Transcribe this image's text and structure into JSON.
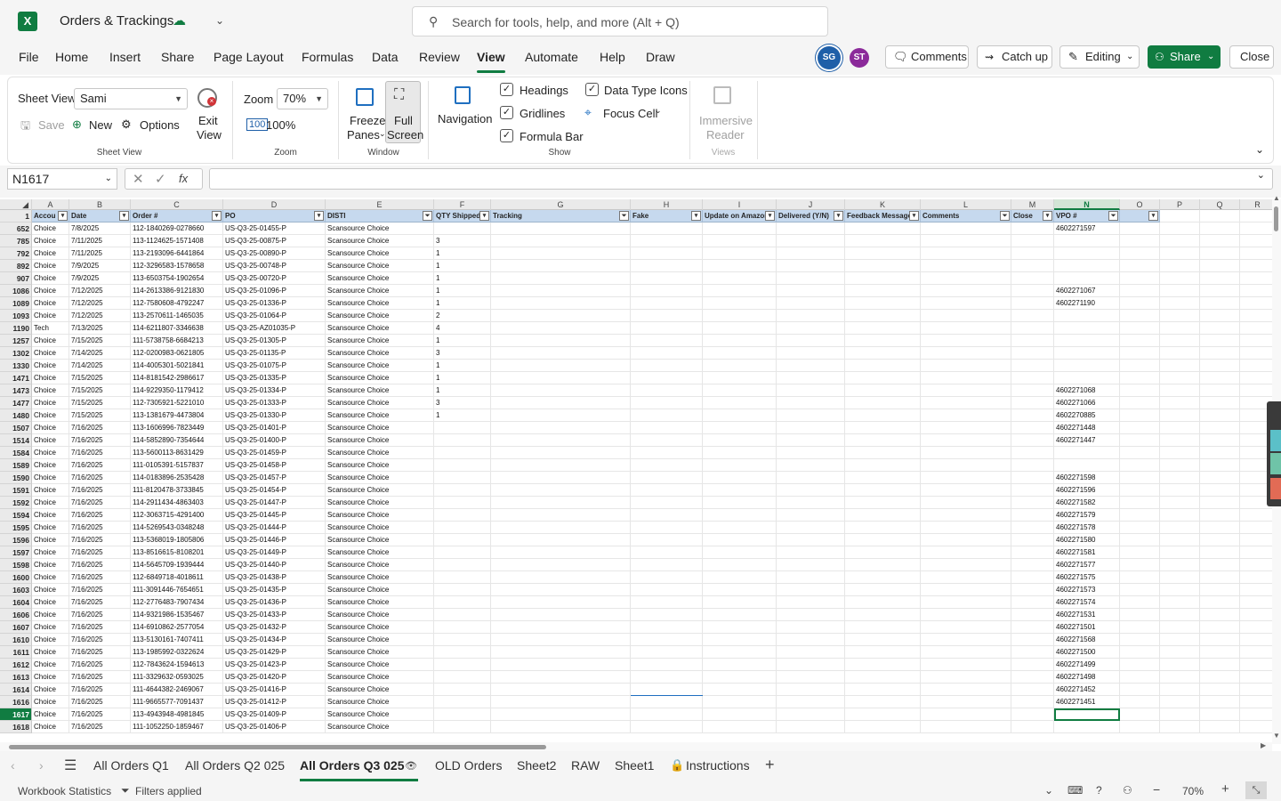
{
  "app": {
    "title": "Orders & Trackings",
    "search_placeholder": "Search for tools, help, and more (Alt + Q)"
  },
  "menu": [
    "File",
    "Home",
    "Insert",
    "Share",
    "Page Layout",
    "Formulas",
    "Data",
    "Review",
    "View",
    "Automate",
    "Help",
    "Draw"
  ],
  "active_menu": "View",
  "avatars": [
    {
      "initials": "SG",
      "color": "#1f5fa8"
    },
    {
      "initials": "ST",
      "color": "#8b2a9a"
    }
  ],
  "header_buttons": {
    "comments": "Comments",
    "catchup": "Catch up",
    "editing": "Editing",
    "share": "Share",
    "close": "Close"
  },
  "ribbon": {
    "sheet_view_label": "Sheet View",
    "sheet_view_value": "Sami",
    "save": "Save",
    "new": "New",
    "options": "Options",
    "exit_view_1": "Exit",
    "exit_view_2": "View",
    "sheet_view_group": "Sheet View",
    "zoom_label": "Zoom",
    "zoom_value": "70%",
    "zoom_100": "100%",
    "zoom_group": "Zoom",
    "freeze_1": "Freeze",
    "freeze_2": "Panes",
    "fullscreen_1": "Full",
    "fullscreen_2": "Screen",
    "window_group": "Window",
    "navigation": "Navigation",
    "headings": "Headings",
    "gridlines": "Gridlines",
    "formula_bar": "Formula Bar",
    "data_type_icons": "Data Type Icons",
    "focus_cell": "Focus Cell",
    "show_group": "Show",
    "immersive_1": "Immersive",
    "immersive_2": "Reader",
    "views_group": "Views"
  },
  "formula": {
    "namebox": "N1617",
    "fx": "fx",
    "content": ""
  },
  "columns": [
    "A",
    "B",
    "C",
    "D",
    "E",
    "F",
    "G",
    "H",
    "I",
    "J",
    "K",
    "L",
    "M",
    "N",
    "O",
    "P",
    "Q",
    "R"
  ],
  "selected_column": "N",
  "header_row_number": "1",
  "headers": [
    "Accou",
    "Date",
    "Order #",
    "PO",
    "DISTI",
    "QTY Shipped",
    "Tracking",
    "Fake",
    "Update on Amazon",
    "Delivered (Y/N)",
    "Feedback Message",
    "Comments",
    "Close",
    "VPO #",
    "",
    "",
    "",
    ""
  ],
  "rows": [
    {
      "num": "652",
      "a": "Choice",
      "b": "7/8/2025",
      "c": "112-1840269-0278660",
      "d": "US-Q3-25-01455-P",
      "e": "Scansource Choice",
      "f": "",
      "n": "4602271597"
    },
    {
      "num": "785",
      "a": "Choice",
      "b": "7/11/2025",
      "c": "113-1124625-1571408",
      "d": "US-Q3-25-00875-P",
      "e": "Scansource Choice",
      "f": "3",
      "n": ""
    },
    {
      "num": "792",
      "a": "Choice",
      "b": "7/11/2025",
      "c": "113-2193096-6441864",
      "d": "US-Q3-25-00890-P",
      "e": "Scansource Choice",
      "f": "1",
      "n": ""
    },
    {
      "num": "892",
      "a": "Choice",
      "b": "7/9/2025",
      "c": "112-3296583-1578658",
      "d": "US-Q3-25-00748-P",
      "e": "Scansource Choice",
      "f": "1",
      "n": ""
    },
    {
      "num": "907",
      "a": "Choice",
      "b": "7/9/2025",
      "c": "113-6503754-1902654",
      "d": "US-Q3-25-00720-P",
      "e": "Scansource Choice",
      "f": "1",
      "n": ""
    },
    {
      "num": "1086",
      "a": "Choice",
      "b": "7/12/2025",
      "c": "114-2613386-9121830",
      "d": "US-Q3-25-01096-P",
      "e": "Scansource Choice",
      "f": "1",
      "n": "4602271067"
    },
    {
      "num": "1089",
      "a": "Choice",
      "b": "7/12/2025",
      "c": "112-7580608-4792247",
      "d": "US-Q3-25-01336-P",
      "e": "Scansource Choice",
      "f": "1",
      "n": "4602271190"
    },
    {
      "num": "1093",
      "a": "Choice",
      "b": "7/12/2025",
      "c": "113-2570611-1465035",
      "d": "US-Q3-25-01064-P",
      "e": "Scansource Choice",
      "f": "2",
      "n": ""
    },
    {
      "num": "1190",
      "a": "Tech",
      "b": "7/13/2025",
      "c": "114-6211807-3346638",
      "d": "US-Q3-25-AZ01035-P",
      "e": "Scansource Choice",
      "f": "4",
      "n": ""
    },
    {
      "num": "1257",
      "a": "Choice",
      "b": "7/15/2025",
      "c": "111-5738758-6684213",
      "d": "US-Q3-25-01305-P",
      "e": "Scansource Choice",
      "f": "1",
      "n": ""
    },
    {
      "num": "1302",
      "a": "Choice",
      "b": "7/14/2025",
      "c": "112-0200983-0621805",
      "d": "US-Q3-25-01135-P",
      "e": "Scansource Choice",
      "f": "3",
      "n": ""
    },
    {
      "num": "1330",
      "a": "Choice",
      "b": "7/14/2025",
      "c": "114-4005301-5021841",
      "d": "US-Q3-25-01075-P",
      "e": "Scansource Choice",
      "f": "1",
      "n": ""
    },
    {
      "num": "1471",
      "a": "Choice",
      "b": "7/15/2025",
      "c": "114-8181542-2986617",
      "d": "US-Q3-25-01335-P",
      "e": "Scansource Choice",
      "f": "1",
      "n": ""
    },
    {
      "num": "1473",
      "a": "Choice",
      "b": "7/15/2025",
      "c": "114-9229350-1179412",
      "d": "US-Q3-25-01334-P",
      "e": "Scansource Choice",
      "f": "1",
      "n": "4602271068"
    },
    {
      "num": "1477",
      "a": "Choice",
      "b": "7/15/2025",
      "c": "112-7305921-5221010",
      "d": "US-Q3-25-01333-P",
      "e": "Scansource Choice",
      "f": "3",
      "n": "4602271066"
    },
    {
      "num": "1480",
      "a": "Choice",
      "b": "7/15/2025",
      "c": "113-1381679-4473804",
      "d": "US-Q3-25-01330-P",
      "e": "Scansource Choice",
      "f": "1",
      "n": "4602270885"
    },
    {
      "num": "1507",
      "a": "Choice",
      "b": "7/16/2025",
      "c": "113-1606996-7823449",
      "d": "US-Q3-25-01401-P",
      "e": "Scansource Choice",
      "f": "",
      "n": "4602271448"
    },
    {
      "num": "1514",
      "a": "Choice",
      "b": "7/16/2025",
      "c": "114-5852890-7354644",
      "d": "US-Q3-25-01400-P",
      "e": "Scansource Choice",
      "f": "",
      "n": "4602271447"
    },
    {
      "num": "1584",
      "a": "Choice",
      "b": "7/16/2025",
      "c": "113-5600113-8631429",
      "d": "US-Q3-25-01459-P",
      "e": "Scansource Choice",
      "f": "",
      "n": ""
    },
    {
      "num": "1589",
      "a": "Choice",
      "b": "7/16/2025",
      "c": "111-0105391-5157837",
      "d": "US-Q3-25-01458-P",
      "e": "Scansource Choice",
      "f": "",
      "n": ""
    },
    {
      "num": "1590",
      "a": "Choice",
      "b": "7/16/2025",
      "c": "114-0183896-2535428",
      "d": "US-Q3-25-01457-P",
      "e": "Scansource Choice",
      "f": "",
      "n": "4602271598"
    },
    {
      "num": "1591",
      "a": "Choice",
      "b": "7/16/2025",
      "c": "111-8120478-3733845",
      "d": "US-Q3-25-01454-P",
      "e": "Scansource Choice",
      "f": "",
      "n": "4602271596"
    },
    {
      "num": "1592",
      "a": "Choice",
      "b": "7/16/2025",
      "c": "114-2911434-4863403",
      "d": "US-Q3-25-01447-P",
      "e": "Scansource Choice",
      "f": "",
      "n": "4602271582"
    },
    {
      "num": "1594",
      "a": "Choice",
      "b": "7/16/2025",
      "c": "112-3063715-4291400",
      "d": "US-Q3-25-01445-P",
      "e": "Scansource Choice",
      "f": "",
      "n": "4602271579"
    },
    {
      "num": "1595",
      "a": "Choice",
      "b": "7/16/2025",
      "c": "114-5269543-0348248",
      "d": "US-Q3-25-01444-P",
      "e": "Scansource Choice",
      "f": "",
      "n": "4602271578"
    },
    {
      "num": "1596",
      "a": "Choice",
      "b": "7/16/2025",
      "c": "113-5368019-1805806",
      "d": "US-Q3-25-01446-P",
      "e": "Scansource Choice",
      "f": "",
      "n": "4602271580"
    },
    {
      "num": "1597",
      "a": "Choice",
      "b": "7/16/2025",
      "c": "113-8516615-8108201",
      "d": "US-Q3-25-01449-P",
      "e": "Scansource Choice",
      "f": "",
      "n": "4602271581"
    },
    {
      "num": "1598",
      "a": "Choice",
      "b": "7/16/2025",
      "c": "114-5645709-1939444",
      "d": "US-Q3-25-01440-P",
      "e": "Scansource Choice",
      "f": "",
      "n": "    4602271577"
    },
    {
      "num": "1600",
      "a": "Choice",
      "b": "7/16/2025",
      "c": "112-6849718-4018611",
      "d": "US-Q3-25-01438-P",
      "e": "Scansource Choice",
      "f": "",
      "n": "4602271575"
    },
    {
      "num": "1603",
      "a": "Choice",
      "b": "7/16/2025",
      "c": "111-3091446-7654651",
      "d": "US-Q3-25-01435-P",
      "e": "Scansource Choice",
      "f": "",
      "n": "4602271573"
    },
    {
      "num": "1604",
      "a": "Choice",
      "b": "7/16/2025",
      "c": "112-2776483-7907434",
      "d": "US-Q3-25-01436-P",
      "e": "Scansource Choice",
      "f": "",
      "n": "4602271574"
    },
    {
      "num": "1606",
      "a": "Choice",
      "b": "7/16/2025",
      "c": "114-9321986-1535467",
      "d": "US-Q3-25-01433-P",
      "e": "Scansource Choice",
      "f": "",
      "n": "4602271531"
    },
    {
      "num": "1607",
      "a": "Choice",
      "b": "7/16/2025",
      "c": "114-6910862-2577054",
      "d": "US-Q3-25-01432-P",
      "e": "Scansource Choice",
      "f": "",
      "n": "4602271501"
    },
    {
      "num": "1610",
      "a": "Choice",
      "b": "7/16/2025",
      "c": "113-5130161-7407411",
      "d": "US-Q3-25-01434-P",
      "e": "Scansource Choice",
      "f": "",
      "n": "4602271568"
    },
    {
      "num": "1611",
      "a": "Choice",
      "b": "7/16/2025",
      "c": "113-1985992-0322624",
      "d": "US-Q3-25-01429-P",
      "e": "Scansource Choice",
      "f": "",
      "n": "4602271500"
    },
    {
      "num": "1612",
      "a": "Choice",
      "b": "7/16/2025",
      "c": "112-7843624-1594613",
      "d": "US-Q3-25-01423-P",
      "e": "Scansource Choice",
      "f": "",
      "n": "4602271499"
    },
    {
      "num": "1613",
      "a": "Choice",
      "b": "7/16/2025",
      "c": "111-3329632-0593025",
      "d": "US-Q3-25-01420-P",
      "e": "Scansource Choice",
      "f": "",
      "n": "4602271498"
    },
    {
      "num": "1614",
      "a": "Choice",
      "b": "7/16/2025",
      "c": "111-4644382-2469067",
      "d": "US-Q3-25-01416-P",
      "e": "Scansource Choice",
      "f": "",
      "n": "4602271452"
    },
    {
      "num": "1616",
      "a": "Choice",
      "b": "7/16/2025",
      "c": "111-9665577-7091437",
      "d": "US-Q3-25-01412-P",
      "e": "Scansource Choice",
      "f": "",
      "n": "4602271451"
    },
    {
      "num": "1617",
      "a": "Choice",
      "b": "7/16/2025",
      "c": "113-4943948-4981845",
      "d": "US-Q3-25-01409-P",
      "e": "Scansource Choice",
      "f": "",
      "n": ""
    },
    {
      "num": "1618",
      "a": "Choice",
      "b": "7/16/2025",
      "c": "111-1052250-1859467",
      "d": "US-Q3-25-01406-P",
      "e": "Scansource Choice",
      "f": "",
      "n": ""
    }
  ],
  "selected_row": "1617",
  "sheet_tabs": [
    "All Orders Q1",
    "All Orders Q2 025",
    "All Orders Q3 025",
    "OLD Orders",
    "Sheet2",
    "RAW",
    "Sheet1",
    "Instructions"
  ],
  "active_sheet": "All Orders Q3 025",
  "status": {
    "workbook_stats": "Workbook Statistics",
    "filters": "Filters applied",
    "zoom": "70%"
  },
  "accent_color": "#107c41"
}
